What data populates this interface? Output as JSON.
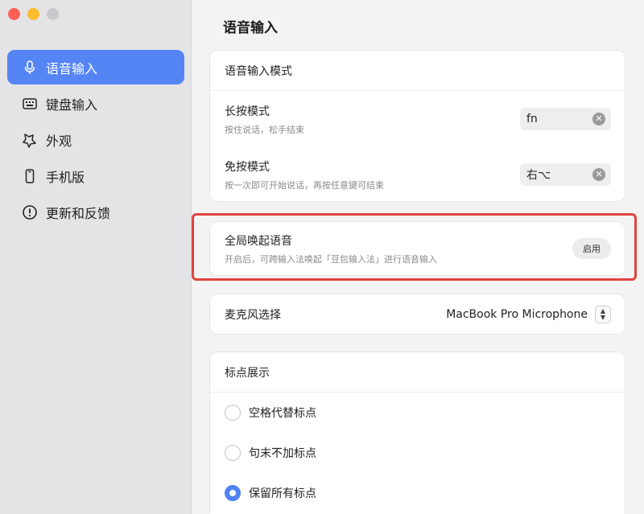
{
  "sidebar": {
    "items": [
      {
        "label": "语音输入",
        "icon": "microphone-icon",
        "active": true
      },
      {
        "label": "键盘输入",
        "icon": "keyboard-icon",
        "active": false
      },
      {
        "label": "外观",
        "icon": "appearance-icon",
        "active": false
      },
      {
        "label": "手机版",
        "icon": "phone-icon",
        "active": false
      },
      {
        "label": "更新和反馈",
        "icon": "info-icon",
        "active": false
      }
    ]
  },
  "main": {
    "title": "语音输入",
    "mode_card": {
      "header": "语音输入模式",
      "rows": [
        {
          "title": "长按模式",
          "subtitle": "按住说话，松手结束",
          "key": "fn"
        },
        {
          "title": "免按模式",
          "subtitle": "按一次即可开始说话，再按任意键可结束",
          "key": "右⌥"
        }
      ]
    },
    "global_card": {
      "title": "全局唤起语音",
      "subtitle": "开启后，可跨输入法唤起「豆包输入法」进行语音输入",
      "button_label": "启用"
    },
    "mic_card": {
      "title": "麦克风选择",
      "value": "MacBook Pro Microphone"
    },
    "punct_card": {
      "header": "标点展示",
      "options": [
        {
          "label": "空格代替标点",
          "checked": false
        },
        {
          "label": "句末不加标点",
          "checked": false
        },
        {
          "label": "保留所有标点",
          "checked": true
        }
      ]
    }
  },
  "colors": {
    "accent": "#5585f5",
    "highlight": "#e0443e"
  }
}
